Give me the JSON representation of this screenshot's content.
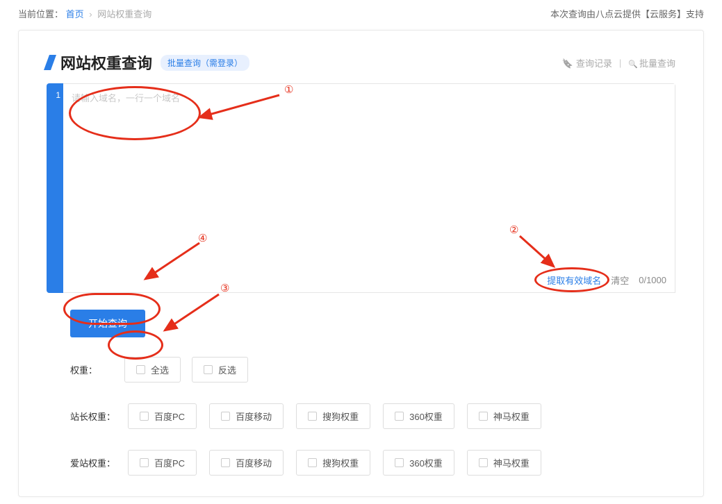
{
  "breadcrumb": {
    "label": "当前位置：",
    "home": "首页",
    "current": "网站权重查询"
  },
  "topRight": "本次查询由八点云提供【云服务】支持",
  "pageTitle": "网站权重查询",
  "bulkBadge": "批量查询（需登录）",
  "titleRight": {
    "history": "查询记录",
    "bulk": "批量查询"
  },
  "gutter": "1",
  "placeholder": "请输入域名，一行一个域名",
  "inputFooter": {
    "extract": "提取有效域名",
    "clear": "清空",
    "count": "0/1000"
  },
  "startBtn": "开始查询",
  "weightRow": {
    "label": "权重：",
    "all": "全选",
    "invert": "反选"
  },
  "siteRows": [
    {
      "label": "站长权重：",
      "items": [
        "百度PC",
        "百度移动",
        "搜狗权重",
        "360权重",
        "神马权重"
      ]
    },
    {
      "label": "爱站权重：",
      "items": [
        "百度PC",
        "百度移动",
        "搜狗权重",
        "360权重",
        "神马权重"
      ]
    }
  ],
  "annotations": {
    "n1": "①",
    "n2": "②",
    "n3": "③",
    "n4": "④"
  }
}
